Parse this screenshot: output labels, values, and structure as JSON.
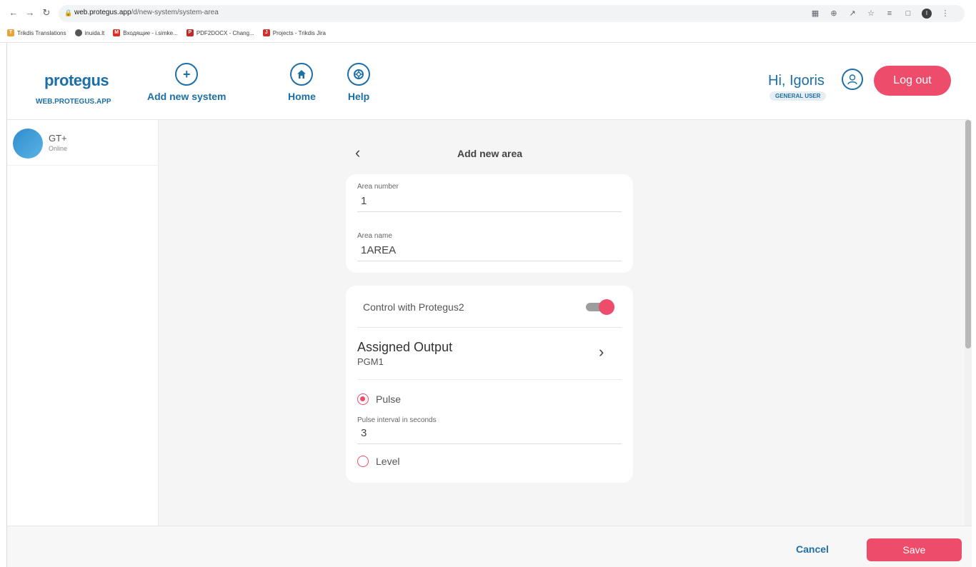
{
  "browser": {
    "url_host": "web.protegus.app",
    "url_path": "/d/new-system/system-area",
    "bookmarks": [
      {
        "label": "Trikdis Translations",
        "color": "#e8a33b"
      },
      {
        "label": "inuida.lt",
        "color": "#555555"
      },
      {
        "label": "Входящие - i.simke...",
        "color": "#d93025"
      },
      {
        "label": "PDF2DOCX - Chang...",
        "color": "#c62828"
      },
      {
        "label": "Projects - Trikdis Jira",
        "color": "#d32f2f"
      }
    ],
    "profile_initial": "I"
  },
  "header": {
    "logo": "protegus",
    "logo_sub": "WEB.PROTEGUS.APP",
    "nav": {
      "add_system": "Add new system",
      "home": "Home",
      "help": "Help"
    },
    "greeting": "Hi, Igoris",
    "role": "GENERAL USER",
    "logout": "Log out"
  },
  "sidebar": {
    "system_name": "GT+",
    "system_status": "Online"
  },
  "main": {
    "title": "Add new area",
    "area_number_label": "Area number",
    "area_number_value": "1",
    "area_name_label": "Area name",
    "area_name_value": "1AREA",
    "control_label": "Control with Protegus2",
    "control_enabled": true,
    "assigned_output_title": "Assigned Output",
    "assigned_output_value": "PGM1",
    "pulse_label": "Pulse",
    "pulse_selected": true,
    "pulse_interval_label": "Pulse interval in seconds",
    "pulse_interval_value": "3",
    "level_label": "Level",
    "level_selected": false
  },
  "footer": {
    "cancel": "Cancel",
    "save": "Save"
  },
  "colors": {
    "accent": "#ee4c6b",
    "brand": "#1d6fa5",
    "background": "#f5f5f5"
  }
}
